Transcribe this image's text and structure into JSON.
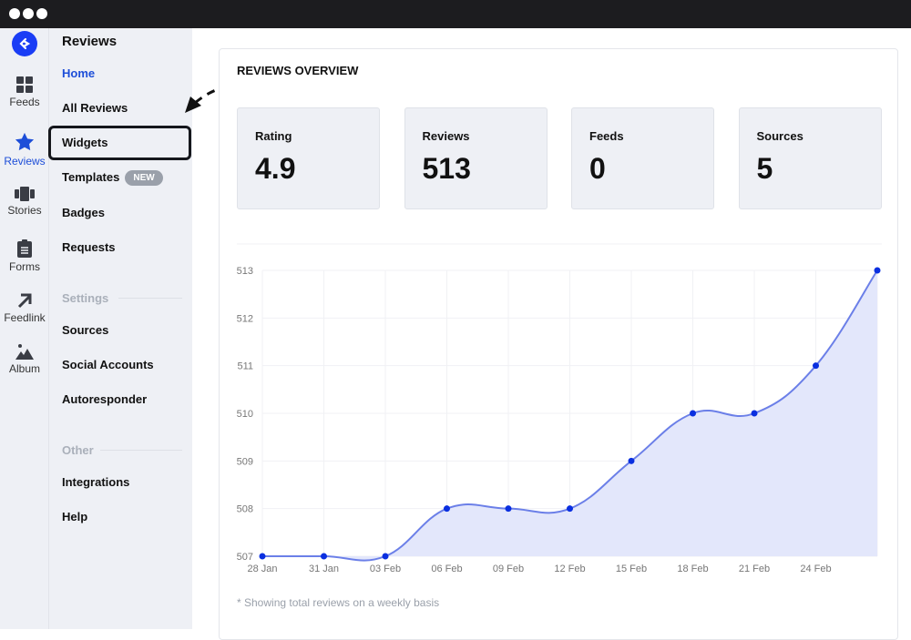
{
  "window": {
    "dots": 3
  },
  "rail": [
    {
      "label": "Feeds",
      "icon": "grid-icon"
    },
    {
      "label": "Reviews",
      "icon": "star-icon",
      "active": true
    },
    {
      "label": "Stories",
      "icon": "stories-icon"
    },
    {
      "label": "Forms",
      "icon": "clipboard-icon"
    },
    {
      "label": "Feedlink",
      "icon": "arrow-up-right-icon"
    },
    {
      "label": "Album",
      "icon": "mountain-image-icon"
    }
  ],
  "panel": {
    "title": "Reviews",
    "items": [
      {
        "label": "Home",
        "active": true
      },
      {
        "label": "All Reviews"
      },
      {
        "label": "Widgets"
      },
      {
        "label": "Templates",
        "badge": "NEW"
      },
      {
        "label": "Badges"
      },
      {
        "label": "Requests"
      }
    ],
    "settings_label": "Settings",
    "settings_items": [
      {
        "label": "Sources"
      },
      {
        "label": "Social Accounts"
      },
      {
        "label": "Autoresponder"
      }
    ],
    "other_label": "Other",
    "other_items": [
      {
        "label": "Integrations"
      },
      {
        "label": "Help"
      }
    ]
  },
  "overview": {
    "title": "REVIEWS OVERVIEW",
    "stats": [
      {
        "label": "Rating",
        "value": "4.9"
      },
      {
        "label": "Reviews",
        "value": "513"
      },
      {
        "label": "Feeds",
        "value": "0"
      },
      {
        "label": "Sources",
        "value": "5"
      }
    ],
    "note": "* Showing total reviews on a weekly basis"
  },
  "colors": {
    "accent": "#1d4ed8",
    "line": "#6b7fe8",
    "fill": "#e3e7fb",
    "point": "#0a2fe0"
  },
  "chart_data": {
    "type": "area",
    "x": [
      "28 Jan",
      "31 Jan",
      "03 Feb",
      "06 Feb",
      "09 Feb",
      "12 Feb",
      "15 Feb",
      "18 Feb",
      "21 Feb",
      "24 Feb",
      ""
    ],
    "values": [
      507,
      507,
      507,
      508,
      508,
      508,
      509,
      510,
      510,
      511,
      513
    ],
    "yticks": [
      507,
      508,
      509,
      510,
      511,
      512,
      513
    ],
    "ylim": [
      507,
      513
    ],
    "grid": true,
    "curve": "smooth"
  }
}
